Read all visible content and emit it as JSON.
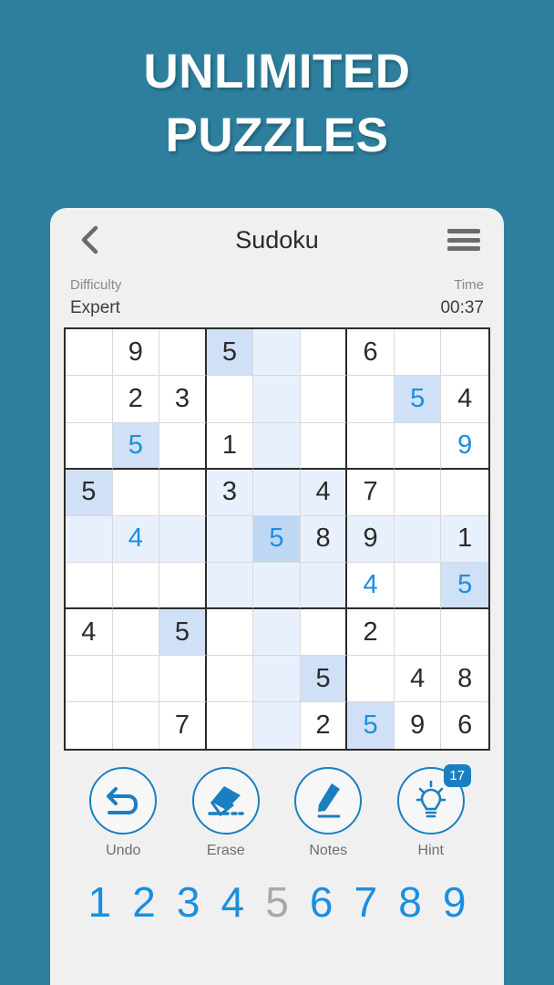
{
  "promo": {
    "line1": "UNLIMITED",
    "line2": "PUZZLES"
  },
  "appbar": {
    "title": "Sudoku",
    "back_icon": "chevron-left-icon",
    "menu_icon": "hamburger-menu-icon"
  },
  "status": {
    "difficulty_label": "Difficulty",
    "difficulty_value": "Expert",
    "time_label": "Time",
    "time_value": "00:37"
  },
  "board": {
    "selected_row": 4,
    "selected_col": 4,
    "active_digit": "5",
    "rows": [
      [
        {
          "v": "",
          "t": "given"
        },
        {
          "v": "9",
          "t": "given"
        },
        {
          "v": "",
          "t": "given"
        },
        {
          "v": "5",
          "t": "given"
        },
        {
          "v": "",
          "t": "given"
        },
        {
          "v": "",
          "t": "given"
        },
        {
          "v": "6",
          "t": "given"
        },
        {
          "v": "",
          "t": "given"
        },
        {
          "v": "",
          "t": "given"
        }
      ],
      [
        {
          "v": "",
          "t": "given"
        },
        {
          "v": "2",
          "t": "given"
        },
        {
          "v": "3",
          "t": "given"
        },
        {
          "v": "",
          "t": "given"
        },
        {
          "v": "",
          "t": "given"
        },
        {
          "v": "",
          "t": "given"
        },
        {
          "v": "",
          "t": "given"
        },
        {
          "v": "5",
          "t": "user"
        },
        {
          "v": "4",
          "t": "given"
        }
      ],
      [
        {
          "v": "",
          "t": "given"
        },
        {
          "v": "5",
          "t": "user"
        },
        {
          "v": "",
          "t": "given"
        },
        {
          "v": "1",
          "t": "given"
        },
        {
          "v": "",
          "t": "given"
        },
        {
          "v": "",
          "t": "given"
        },
        {
          "v": "",
          "t": "given"
        },
        {
          "v": "",
          "t": "given"
        },
        {
          "v": "9",
          "t": "user"
        }
      ],
      [
        {
          "v": "5",
          "t": "given"
        },
        {
          "v": "",
          "t": "given"
        },
        {
          "v": "",
          "t": "given"
        },
        {
          "v": "3",
          "t": "given"
        },
        {
          "v": "",
          "t": "given"
        },
        {
          "v": "4",
          "t": "given"
        },
        {
          "v": "7",
          "t": "given"
        },
        {
          "v": "",
          "t": "given"
        },
        {
          "v": "",
          "t": "given"
        }
      ],
      [
        {
          "v": "",
          "t": "given"
        },
        {
          "v": "4",
          "t": "user"
        },
        {
          "v": "",
          "t": "given"
        },
        {
          "v": "",
          "t": "given"
        },
        {
          "v": "5",
          "t": "user"
        },
        {
          "v": "8",
          "t": "given"
        },
        {
          "v": "9",
          "t": "given"
        },
        {
          "v": "",
          "t": "given"
        },
        {
          "v": "1",
          "t": "given"
        }
      ],
      [
        {
          "v": "",
          "t": "given"
        },
        {
          "v": "",
          "t": "given"
        },
        {
          "v": "",
          "t": "given"
        },
        {
          "v": "",
          "t": "given"
        },
        {
          "v": "",
          "t": "given"
        },
        {
          "v": "",
          "t": "given"
        },
        {
          "v": "4",
          "t": "user"
        },
        {
          "v": "",
          "t": "given"
        },
        {
          "v": "5",
          "t": "user"
        }
      ],
      [
        {
          "v": "4",
          "t": "given"
        },
        {
          "v": "",
          "t": "given"
        },
        {
          "v": "5",
          "t": "given"
        },
        {
          "v": "",
          "t": "given"
        },
        {
          "v": "",
          "t": "given"
        },
        {
          "v": "",
          "t": "given"
        },
        {
          "v": "2",
          "t": "given"
        },
        {
          "v": "",
          "t": "given"
        },
        {
          "v": "",
          "t": "given"
        }
      ],
      [
        {
          "v": "",
          "t": "given"
        },
        {
          "v": "",
          "t": "given"
        },
        {
          "v": "",
          "t": "given"
        },
        {
          "v": "",
          "t": "given"
        },
        {
          "v": "",
          "t": "given"
        },
        {
          "v": "5",
          "t": "given"
        },
        {
          "v": "",
          "t": "given"
        },
        {
          "v": "4",
          "t": "given"
        },
        {
          "v": "8",
          "t": "given"
        }
      ],
      [
        {
          "v": "",
          "t": "given"
        },
        {
          "v": "",
          "t": "given"
        },
        {
          "v": "7",
          "t": "given"
        },
        {
          "v": "",
          "t": "given"
        },
        {
          "v": "",
          "t": "given"
        },
        {
          "v": "2",
          "t": "given"
        },
        {
          "v": "5",
          "t": "user"
        },
        {
          "v": "9",
          "t": "given"
        },
        {
          "v": "6",
          "t": "given"
        }
      ]
    ]
  },
  "actions": [
    {
      "label": "Undo",
      "icon": "undo-arrow-icon",
      "badge": ""
    },
    {
      "label": "Erase",
      "icon": "eraser-icon",
      "badge": ""
    },
    {
      "label": "Notes",
      "icon": "pencil-icon",
      "badge": ""
    },
    {
      "label": "Hint",
      "icon": "lightbulb-icon",
      "badge": "17"
    }
  ],
  "numpad": [
    {
      "d": "1",
      "used": false
    },
    {
      "d": "2",
      "used": false
    },
    {
      "d": "3",
      "used": false
    },
    {
      "d": "4",
      "used": false
    },
    {
      "d": "5",
      "used": true
    },
    {
      "d": "6",
      "used": false
    },
    {
      "d": "7",
      "used": false
    },
    {
      "d": "8",
      "used": false
    },
    {
      "d": "9",
      "used": false
    }
  ],
  "colors": {
    "background": "#2e7f9e",
    "accent": "#1a8fe0",
    "card": "#f0f0f0",
    "peer_highlight": "#e9f0fd",
    "same_number": "#cfe0f7",
    "selected": "#bed8f4"
  }
}
